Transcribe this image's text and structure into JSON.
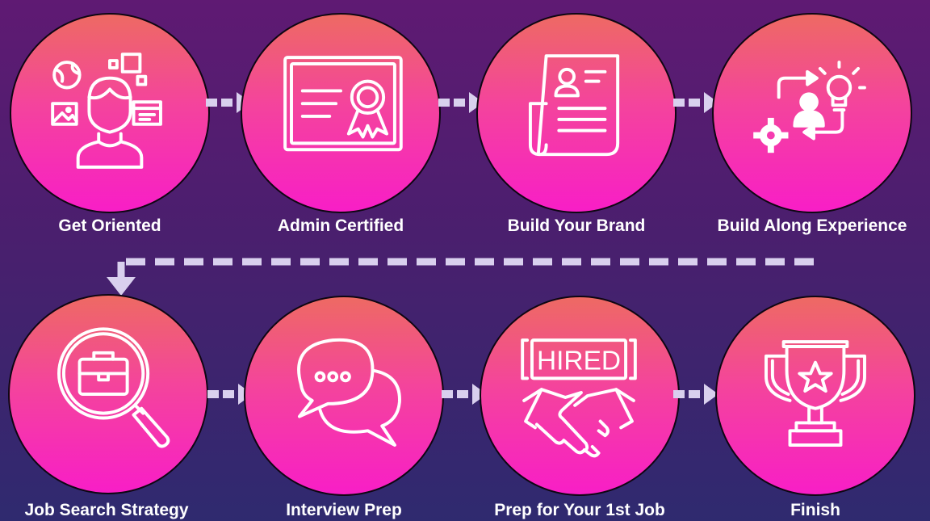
{
  "colors": {
    "accent": "#f42fb0",
    "connector": "#d9d0ee",
    "icon_stroke": "#ffffff"
  },
  "steps": [
    {
      "label": "Get Oriented",
      "icon": "user-with-apps-icon"
    },
    {
      "label": "Admin Certified",
      "icon": "certificate-icon"
    },
    {
      "label": "Build Your Brand",
      "icon": "resume-document-icon"
    },
    {
      "label": "Build Along Experience",
      "icon": "workflow-lightbulb-icon"
    },
    {
      "label": "Job Search Strategy",
      "icon": "briefcase-search-icon"
    },
    {
      "label": "Interview Prep",
      "icon": "chat-bubbles-icon"
    },
    {
      "label": "Prep for Your 1st Job",
      "icon": "hired-handshake-icon"
    },
    {
      "label": "Finish",
      "icon": "trophy-icon"
    }
  ],
  "hired_sign_text": "HIRED"
}
